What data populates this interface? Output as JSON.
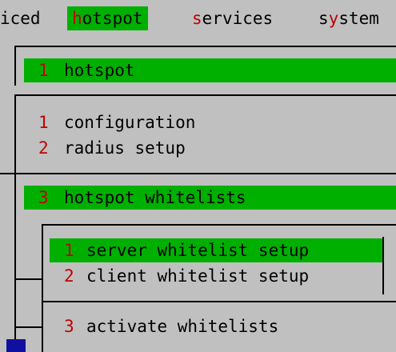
{
  "menubar": {
    "items": [
      {
        "label": "iced",
        "hot_index": -1
      },
      {
        "label": "hotspot",
        "hot_index": 0,
        "selected": true
      },
      {
        "label": "services",
        "hot_index": 0
      },
      {
        "label": "system",
        "hot_index": 2
      }
    ]
  },
  "menu1": {
    "header": {
      "num": "1",
      "label": "hotspot"
    }
  },
  "menu2": {
    "items": [
      {
        "num": "1",
        "label": "configuration"
      },
      {
        "num": "2",
        "label": "radius setup"
      }
    ],
    "selected": {
      "num": "3",
      "label": "hotspot whitelists"
    }
  },
  "menu3": {
    "items": [
      {
        "num": "1",
        "label": "server whitelist setup",
        "selected": true
      },
      {
        "num": "2",
        "label": "client whitelist setup"
      }
    ],
    "bottom_item": {
      "num": "3",
      "label": "activate whitelists"
    }
  },
  "colors": {
    "background": "#c0c0c0",
    "highlight": "#00b000",
    "hotkey": "#c00000",
    "text": "#000000"
  }
}
